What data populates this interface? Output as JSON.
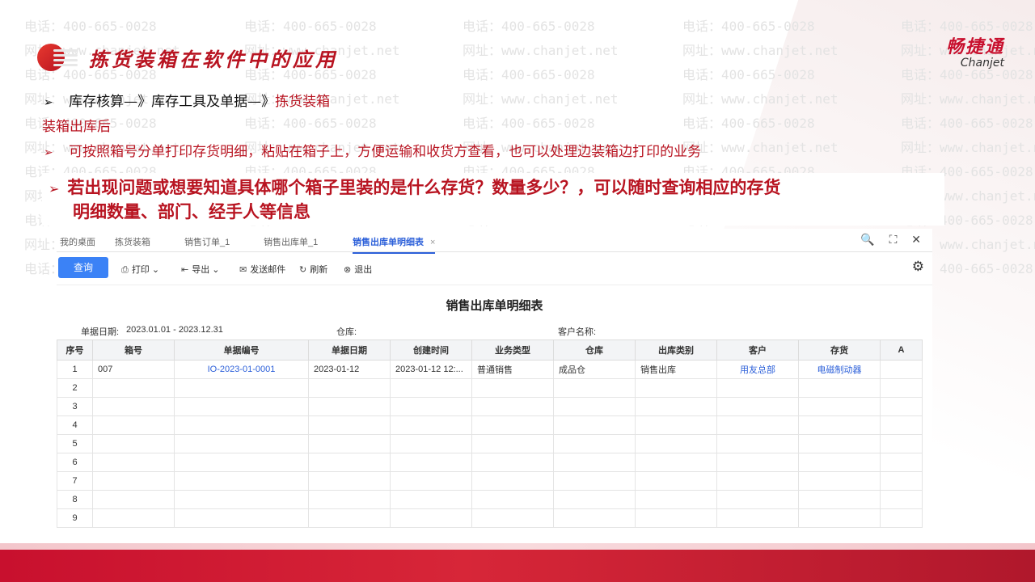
{
  "slide": {
    "title": "拣货装箱在软件中的应用",
    "brand_cn": "畅捷通",
    "brand_en": "Chanjet",
    "line1_prefix": "库存核算—》库存工具及单据—》",
    "line1_highlight": "拣货装箱",
    "line2": "装箱出库后",
    "line3": "可按照箱号分单打印存货明细，粘贴在箱子上，方便运输和收货方查看，也可以处理边装箱边打印的业务",
    "line4a": "若出现问题或想要知道具体哪个箱子里装的是什么存货？数量多少？，可以随时查询相应的存货",
    "line4b": "明细数量、部门、经手人等信息",
    "bullet": "➢",
    "watermark_phone": "电话：400-665-0028",
    "watermark_url": "网址：www.chanjet.net"
  },
  "app": {
    "tabs": [
      {
        "label": "我的桌面"
      },
      {
        "label": "拣货装箱"
      },
      {
        "label": "销售订单_1"
      },
      {
        "label": "销售出库单_1"
      },
      {
        "label": "销售出库单明细表"
      }
    ],
    "tab_close": "×",
    "window_controls": {
      "search": "🔍",
      "maximize": "⛶",
      "close": "✕"
    },
    "toolbar": {
      "query": "查询",
      "print": "打印",
      "export": "导出",
      "send_mail": "发送邮件",
      "refresh": "刷新",
      "exit": "退出"
    },
    "report_title": "销售出库单明细表",
    "filters": {
      "date_label": "单据日期:",
      "date_value": "2023.01.01 - 2023.12.31",
      "warehouse_label": "仓库:",
      "customer_label": "客户名称:"
    },
    "table": {
      "headers": [
        "序号",
        "箱号",
        "单据编号",
        "单据日期",
        "创建时间",
        "业务类型",
        "仓库",
        "出库类别",
        "客户",
        "存货",
        "A"
      ],
      "rows": [
        [
          "1",
          "007",
          "IO-2023-01-0001",
          "2023-01-12",
          "2023-01-12 12:...",
          "普通销售",
          "成品仓",
          "销售出库",
          "用友总部",
          "电磁制动器",
          ""
        ],
        [
          "2",
          "",
          "",
          "",
          "",
          "",
          "",
          "",
          "",
          "",
          ""
        ],
        [
          "3",
          "",
          "",
          "",
          "",
          "",
          "",
          "",
          "",
          "",
          ""
        ],
        [
          "4",
          "",
          "",
          "",
          "",
          "",
          "",
          "",
          "",
          "",
          ""
        ],
        [
          "5",
          "",
          "",
          "",
          "",
          "",
          "",
          "",
          "",
          "",
          ""
        ],
        [
          "6",
          "",
          "",
          "",
          "",
          "",
          "",
          "",
          "",
          "",
          ""
        ],
        [
          "7",
          "",
          "",
          "",
          "",
          "",
          "",
          "",
          "",
          "",
          ""
        ],
        [
          "8",
          "",
          "",
          "",
          "",
          "",
          "",
          "",
          "",
          "",
          ""
        ],
        [
          "9",
          "",
          "",
          "",
          "",
          "",
          "",
          "",
          "",
          "",
          ""
        ]
      ]
    }
  }
}
